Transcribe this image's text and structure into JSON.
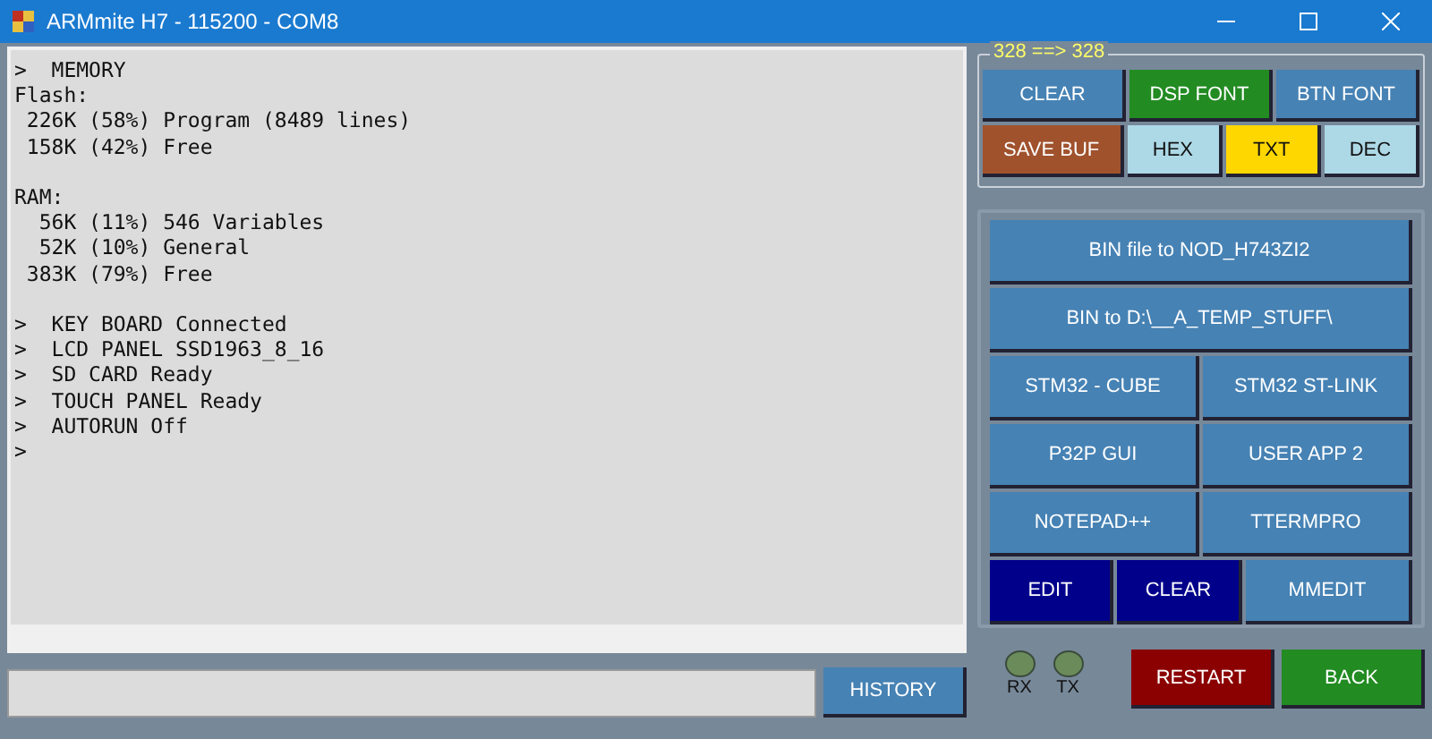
{
  "window": {
    "title": "ARMmite H7 -  115200 - COM8"
  },
  "console": {
    "blocks": [
      [
        ">  MEMORY",
        "Flash:",
        " 226K (58%) Program (8489 lines)",
        " 158K (42%) Free"
      ],
      [
        "RAM:",
        "  56K (11%) 546 Variables",
        "  52K (10%) General",
        " 383K (79%) Free"
      ],
      [
        ">  KEY BOARD Connected",
        ">  LCD PANEL SSD1963_8_16",
        ">  SD CARD Ready",
        ">  TOUCH PANEL Ready",
        ">  AUTORUN Off",
        ">"
      ]
    ]
  },
  "command": {
    "button": "HISTORY"
  },
  "display_group": {
    "legend": "328 ==> 328",
    "upper_buttons": [
      {
        "label": "CLEAR",
        "color": "#4682b4"
      },
      {
        "label": "DSP FONT",
        "color": "#228b22"
      },
      {
        "label": "BTN FONT",
        "color": "#4682b4"
      }
    ],
    "lower_buttons": [
      {
        "label": "SAVE BUF",
        "color": "#a0522d"
      },
      {
        "label": "HEX",
        "color": "#add8e6"
      },
      {
        "label": "TXT",
        "color": "#ffd700"
      },
      {
        "label": "DEC",
        "color": "#add8e6"
      }
    ]
  },
  "tools_group": {
    "rows": [
      [
        {
          "label": "BIN file to NOD_H743ZI2",
          "color": "#4682b4"
        }
      ],
      [
        {
          "label": "BIN to D:\\__A_TEMP_STUFF\\",
          "color": "#4682b4"
        }
      ],
      [
        {
          "label": "STM32 - CUBE",
          "color": "#4682b4"
        },
        {
          "label": "STM32 ST-LINK",
          "color": "#4682b4"
        }
      ],
      [
        {
          "label": "P32P GUI",
          "color": "#4682b4"
        },
        {
          "label": "USER APP 2",
          "color": "#4682b4"
        }
      ],
      [
        {
          "label": "NOTEPAD++",
          "color": "#4682b4"
        },
        {
          "label": "TTERMPRO",
          "color": "#4682b4"
        }
      ],
      [
        {
          "label": "EDIT",
          "color": "#00008b"
        },
        {
          "label": "CLEAR",
          "color": "#00008b"
        },
        {
          "label": "MMEDIT",
          "color": "#4682b4"
        }
      ]
    ]
  },
  "leds": [
    {
      "label": "RX"
    },
    {
      "label": "TX"
    }
  ],
  "actions": [
    {
      "label": "RESTART",
      "color": "#8b0000"
    },
    {
      "label": "BACK",
      "color": "#228b22"
    }
  ]
}
